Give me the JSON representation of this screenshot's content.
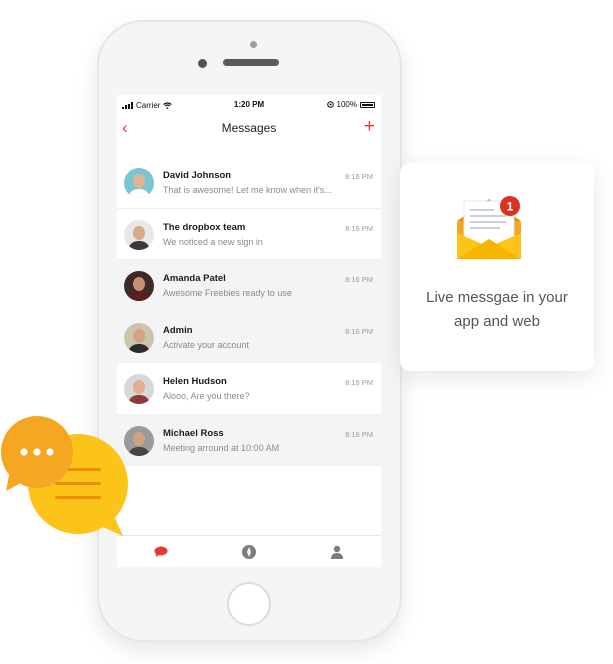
{
  "status_bar": {
    "carrier": "Carrier",
    "time": "1:20 PM",
    "battery": "100%"
  },
  "nav": {
    "title": "Messages",
    "back_icon": "chevron-left-icon",
    "add_icon": "plus-icon"
  },
  "messages": [
    {
      "name": "David Johnson",
      "preview": "That is awesome! Let me know when it's...",
      "time": "8:16 PM"
    },
    {
      "name": "The dropbox team",
      "preview": "We noticed a new sign in",
      "time": "8:16 PM"
    },
    {
      "name": "Amanda Patel",
      "preview": "Awesome Freebies ready to use",
      "time": "8:16 PM"
    },
    {
      "name": "Admin",
      "preview": "Activate your account",
      "time": "8:16 PM"
    },
    {
      "name": "Helen Hudson",
      "preview": "Alooo, Are you there?",
      "time": "8:16 PM"
    },
    {
      "name": "Michael Ross",
      "preview": "Meeting arround at 10:00 AM",
      "time": "8:16 PM"
    }
  ],
  "tabs": [
    "chat-bubble-icon",
    "compass-icon",
    "profile-icon"
  ],
  "card": {
    "caption_line1": "Live messgae in your",
    "caption_line2": "app and web",
    "notification_count": "1"
  },
  "colors": {
    "accent": "#e53935",
    "bubble_orange": "#f5a623",
    "bubble_yellow": "#fcc419"
  }
}
